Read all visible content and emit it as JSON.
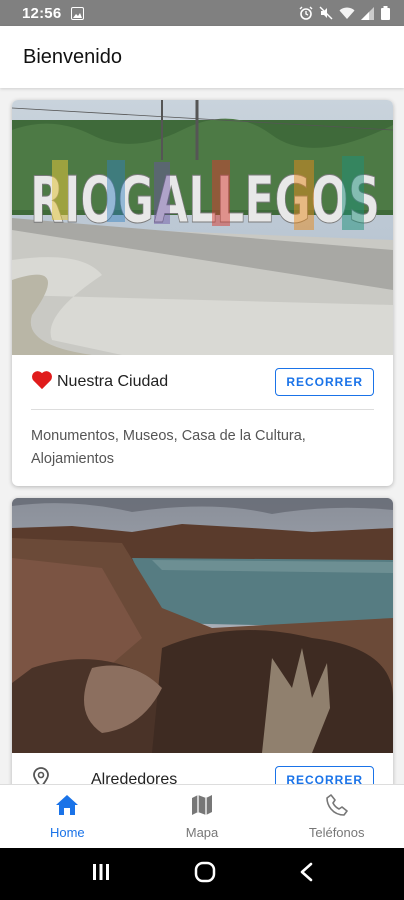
{
  "status_bar": {
    "time": "12:56",
    "icons": [
      "image-notification-icon",
      "alarm-icon",
      "mute-icon",
      "wifi-icon",
      "signal-icon",
      "battery-icon"
    ]
  },
  "app_bar": {
    "title": "Bienvenido"
  },
  "cards": [
    {
      "image": "rio-gallegos-sign-photo",
      "icon": "heart-icon",
      "icon_color": "#e01c1c",
      "title": "Nuestra Ciudad",
      "button_label": "RECORRER",
      "description": "Monumentos, Museos, Casa de la Cultura, Alojamientos"
    },
    {
      "image": "lagoon-landscape-photo",
      "icon": "location-pin-icon",
      "title": "Alrededores",
      "button_label": "RECORRER"
    }
  ],
  "bottom_nav": {
    "items": [
      {
        "label": "Home",
        "icon": "home-icon",
        "active": true
      },
      {
        "label": "Mapa",
        "icon": "map-icon",
        "active": false
      },
      {
        "label": "Teléfonos",
        "icon": "phone-icon",
        "active": false
      }
    ]
  },
  "colors": {
    "accent": "#1a73e8",
    "heart": "#e01c1c",
    "status_bar": "#808080"
  },
  "android_nav": {
    "icons": [
      "recents-icon",
      "home-circle-icon",
      "back-icon"
    ]
  }
}
